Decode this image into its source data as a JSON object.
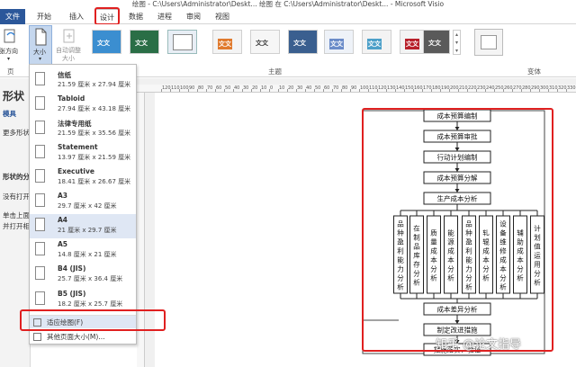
{
  "window": {
    "title": "绘图 - C:\\Users\\Administrator\\Deskt... 绘图 在 C:\\Users\\Administrator\\Deskt... - Microsoft Visio"
  },
  "tabs": [
    {
      "label": "文件"
    },
    {
      "label": "开始"
    },
    {
      "label": "插入"
    },
    {
      "label": "设计"
    },
    {
      "label": "数据"
    },
    {
      "label": "进程"
    },
    {
      "label": "审阅"
    },
    {
      "label": "视图"
    }
  ],
  "ribbon": {
    "orientation_label": "纸张方向",
    "size_label": "大小",
    "autosize_label_1": "自动调整",
    "autosize_label_2": "大小",
    "group_page": "页",
    "group_themes": "主题",
    "group_variants": "变体",
    "theme_text": "文文",
    "theme_colors": [
      "#3b8ed0",
      "#2a6e46",
      "#e8eef5",
      "#e07a2e",
      "#ddd",
      "#3a5f8f",
      "#6b8cc9",
      "#4da0c9",
      "#b8202a",
      "#5a5a5a"
    ]
  },
  "left_pane": {
    "title": "形状",
    "sub1": "模具",
    "sub2": "更多形状",
    "text1": "形状的分",
    "text2": "没有打开",
    "text3": "单击上面",
    "text4": "并打开相"
  },
  "size_menu": {
    "items": [
      {
        "name": "信纸",
        "dims": "21.59 厘米 x 27.94 厘米"
      },
      {
        "name": "Tabloid",
        "dims": "27.94 厘米 x 43.18 厘米"
      },
      {
        "name": "法律专用纸",
        "dims": "21.59 厘米 x 35.56 厘米"
      },
      {
        "name": "Statement",
        "dims": "13.97 厘米 x 21.59 厘米"
      },
      {
        "name": "Executive",
        "dims": "18.41 厘米 x 26.67 厘米"
      },
      {
        "name": "A3",
        "dims": "29.7 厘米 x 42 厘米"
      },
      {
        "name": "A4",
        "dims": "21 厘米 x 29.7 厘米"
      },
      {
        "name": "A5",
        "dims": "14.8 厘米 x 21 厘米"
      },
      {
        "name": "B4 (JIS)",
        "dims": "25.7 厘米 x 36.4 厘米"
      },
      {
        "name": "B5 (JIS)",
        "dims": "18.2 厘米 x 25.7 厘米"
      }
    ],
    "fit_to_drawing": "适应绘图(F)",
    "more_sizes": "其他页面大小(M)..."
  },
  "ruler": {
    "ticks": [
      "120",
      "110",
      "100",
      "90",
      "80",
      "70",
      "60",
      "50",
      "40",
      "30",
      "20",
      "10",
      "0",
      "10",
      "20",
      "30",
      "40",
      "50",
      "60",
      "70",
      "80",
      "90",
      "100",
      "110",
      "120",
      "130",
      "140",
      "150",
      "160",
      "170",
      "180",
      "190",
      "200",
      "210",
      "220",
      "230",
      "240",
      "250",
      "260",
      "270",
      "280",
      "290",
      "300",
      "310",
      "320",
      "330"
    ]
  },
  "flowchart": {
    "top_boxes": [
      "成本预算编制",
      "成本预算审批",
      "行动计划编制",
      "成本预算分解",
      "生产成本分析"
    ],
    "analysis_boxes": [
      "品种盈利能力分析",
      "在制品库存分析",
      "质量成本分析",
      "能源成本分析",
      "品种盈利能力分析",
      "轧辊成本分析",
      "设备维修成本分析",
      "辅助成本分析",
      "计划值运用分析"
    ],
    "bottom_boxes": [
      "成本差异分析",
      "制定改进措施",
      "措施落实、验证"
    ]
  },
  "watermark": "知乎 @论文指导"
}
